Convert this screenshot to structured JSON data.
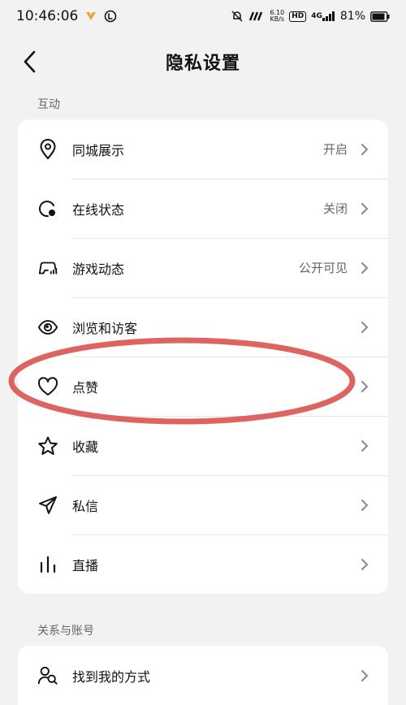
{
  "status_bar": {
    "time": "10:46:06",
    "net_speed_value": "6.10",
    "net_speed_unit": "KB/s",
    "hd_label": "HD",
    "network_type": "4G",
    "battery_percent": "81%"
  },
  "header": {
    "title": "隐私设置"
  },
  "sections": [
    {
      "title": "互动",
      "items": [
        {
          "label": "同城展示",
          "value": "开启",
          "icon": "location-pin-icon"
        },
        {
          "label": "在线状态",
          "value": "关闭",
          "icon": "online-status-icon"
        },
        {
          "label": "游戏动态",
          "value": "公开可见",
          "icon": "game-controller-icon"
        },
        {
          "label": "浏览和访客",
          "value": "",
          "icon": "eye-icon"
        },
        {
          "label": "点赞",
          "value": "",
          "icon": "heart-icon"
        },
        {
          "label": "收藏",
          "value": "",
          "icon": "star-icon"
        },
        {
          "label": "私信",
          "value": "",
          "icon": "send-icon"
        },
        {
          "label": "直播",
          "value": "",
          "icon": "live-bars-icon"
        }
      ]
    },
    {
      "title": "关系与账号",
      "items": [
        {
          "label": "找到我的方式",
          "value": "",
          "icon": "find-user-icon"
        }
      ]
    }
  ],
  "colors": {
    "background": "#f2f2f2",
    "card": "#ffffff",
    "annotation": "#d9534f",
    "status_accent": "#f0a030"
  }
}
